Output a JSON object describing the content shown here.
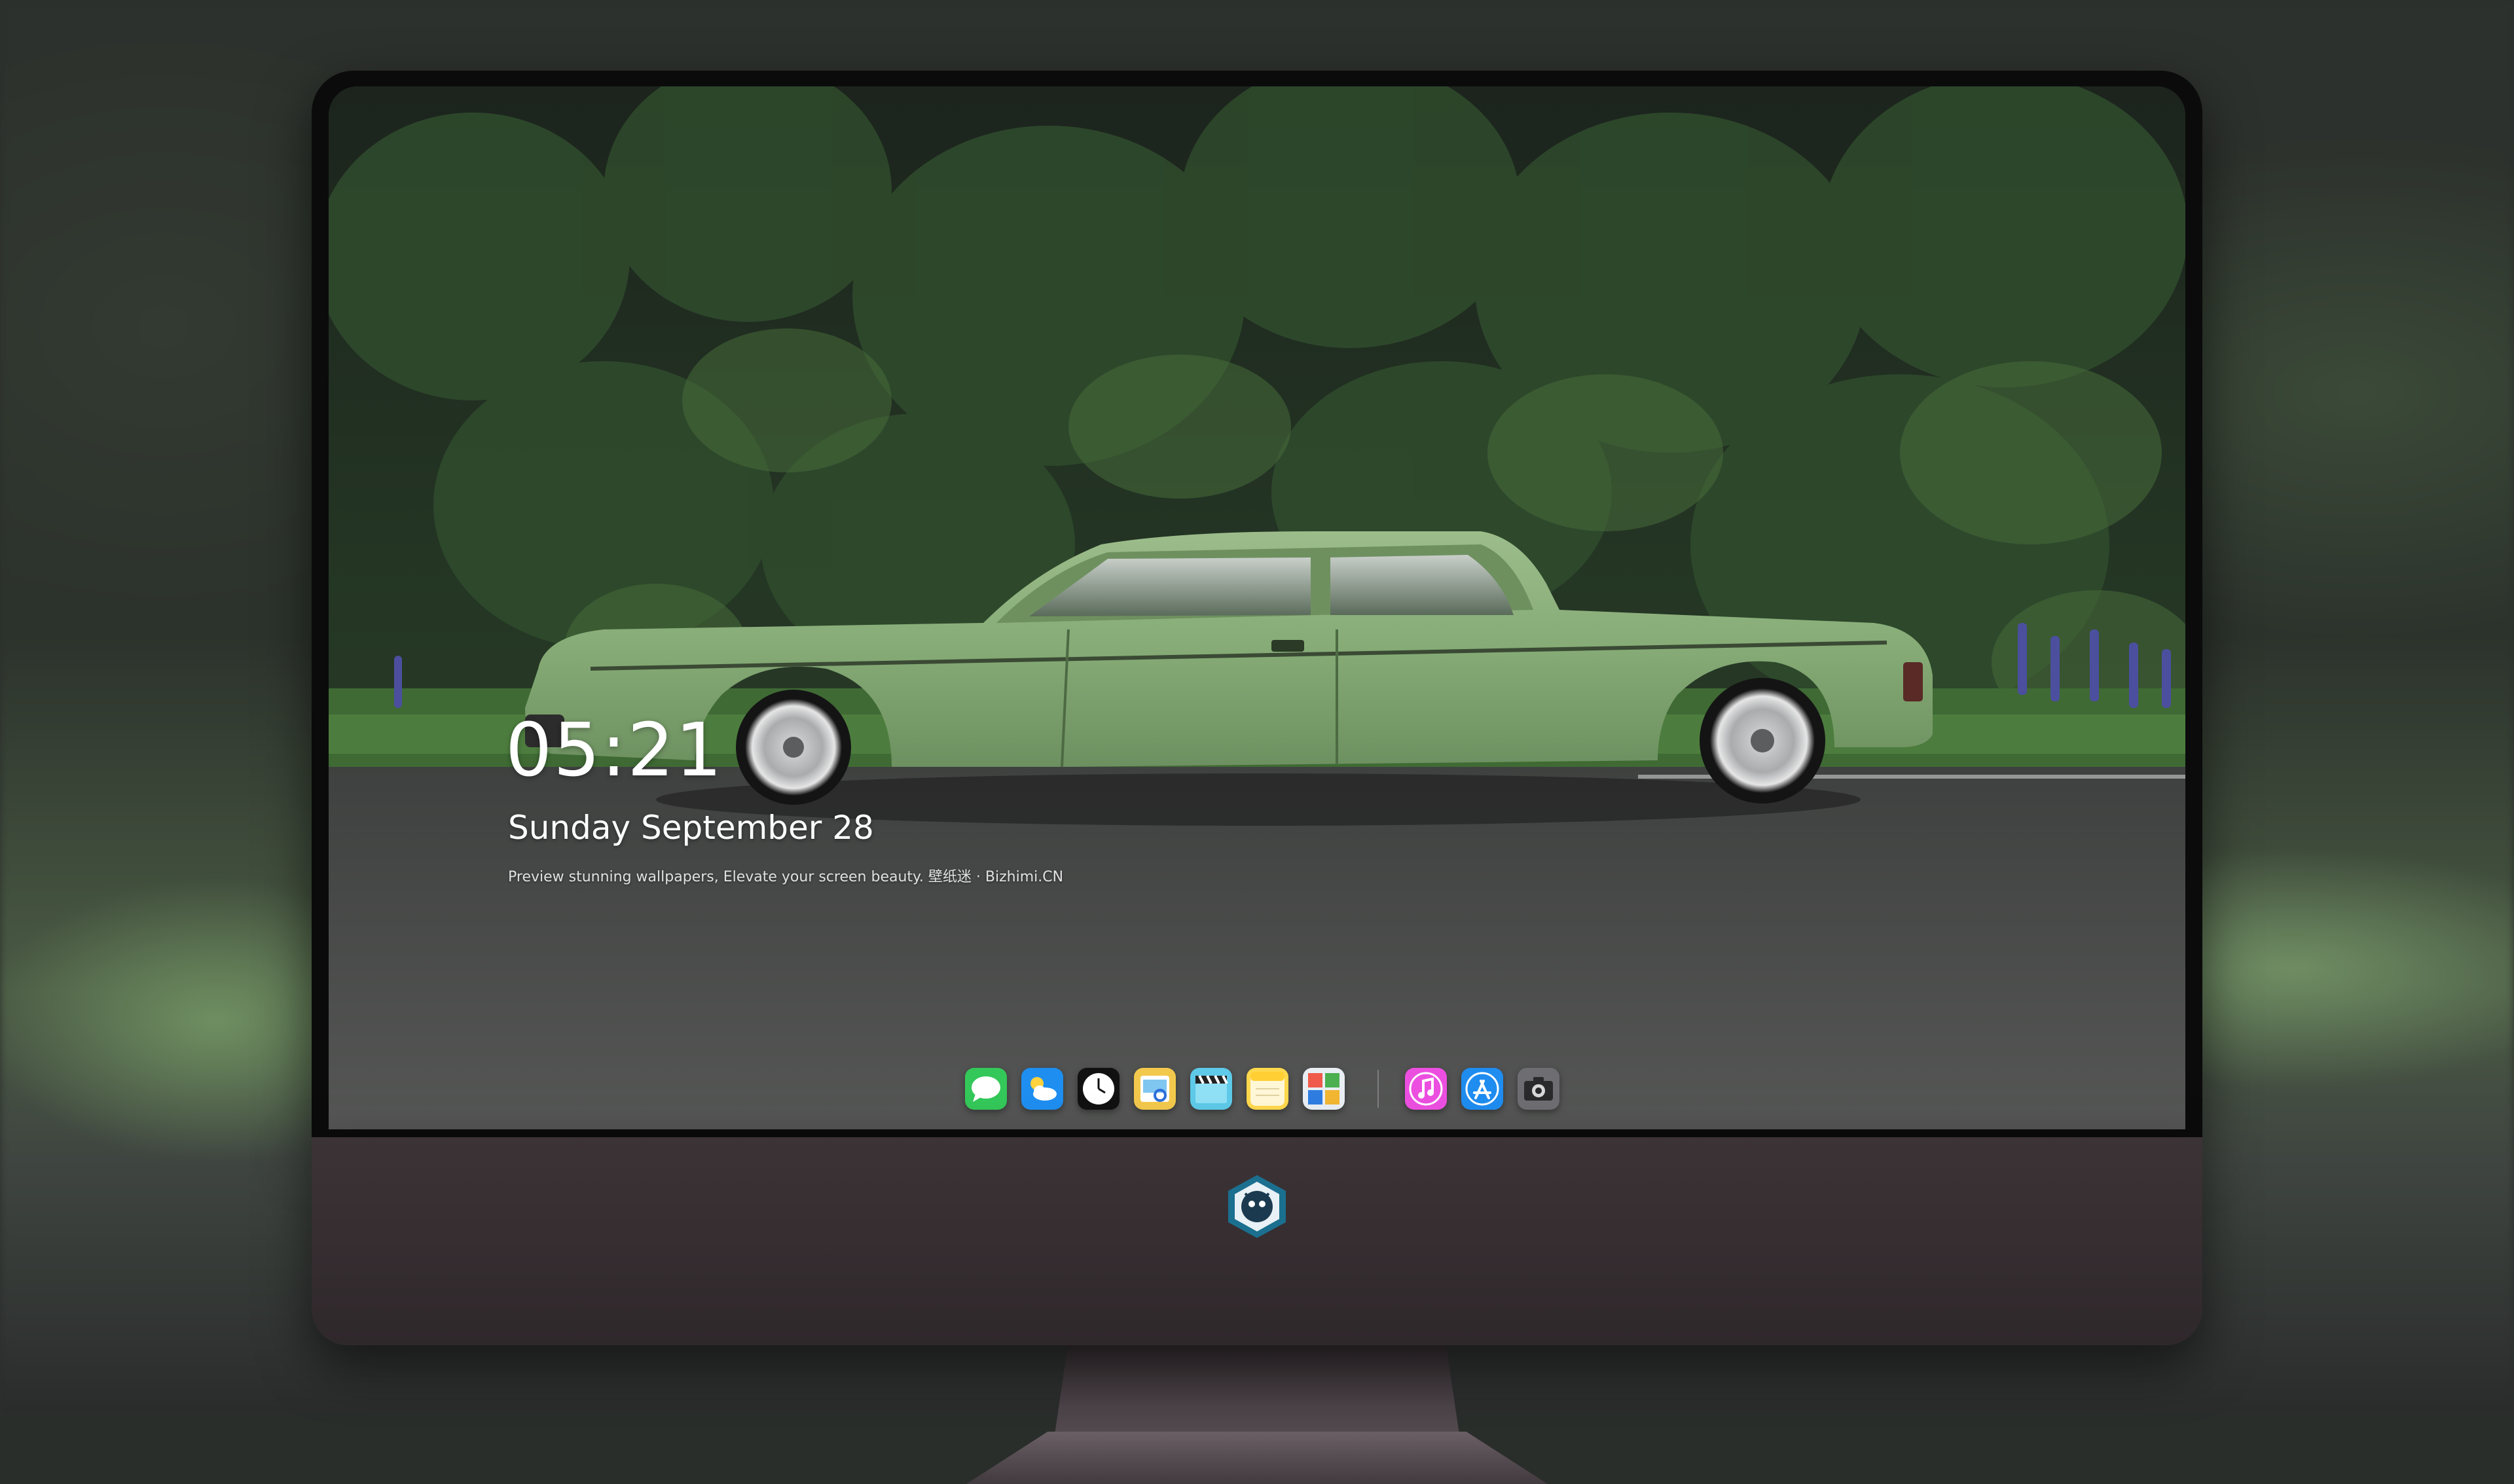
{
  "lockscreen": {
    "time": "05:21",
    "date": "Sunday September  28",
    "tagline": "Preview stunning wallpapers, Elevate your screen beauty. 壁纸迷 · Bizhimi.CN"
  },
  "dock": {
    "apps": [
      {
        "name": "messages-icon",
        "color": "#34c759"
      },
      {
        "name": "weather-icon",
        "color": "#1e8ef0"
      },
      {
        "name": "clock-icon",
        "color": "#111111"
      },
      {
        "name": "preview-icon",
        "color": "#f2c94c"
      },
      {
        "name": "video-clapper-icon",
        "color": "#5ec9e8"
      },
      {
        "name": "notes-icon",
        "color": "#ffd84d"
      },
      {
        "name": "photo-booth-icon",
        "color": "#e8eef4"
      },
      {
        "name": "music-icon",
        "color": "#ec4fe0"
      },
      {
        "name": "app-store-icon",
        "color": "#1f8cf0"
      },
      {
        "name": "camera-icon",
        "color": "#6d6d72"
      }
    ]
  },
  "colors": {
    "car_green": "#86ab76",
    "forest_dark": "#1c2a1c",
    "road": "#4a4a4c",
    "chin": "#362e31"
  }
}
